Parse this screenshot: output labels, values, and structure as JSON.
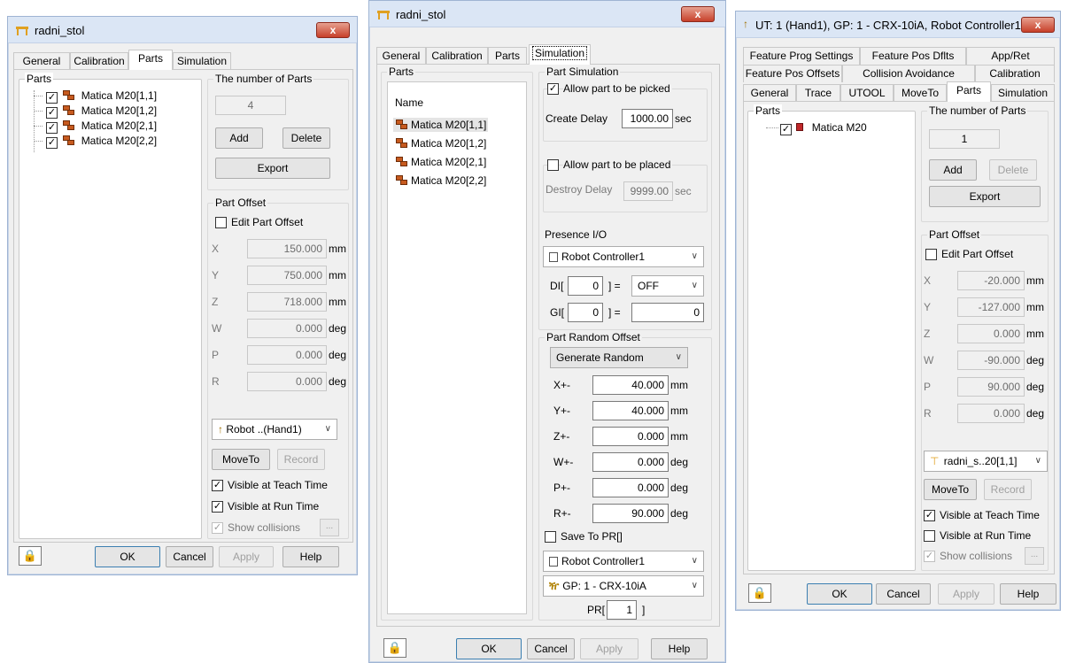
{
  "win1": {
    "title": "radni_stol",
    "close": "x",
    "tabs": [
      "General",
      "Calibration",
      "Parts",
      "Simulation"
    ],
    "parts_label": "Parts",
    "parts": [
      "Matica M20[1,1]",
      "Matica M20[1,2]",
      "Matica M20[2,1]",
      "Matica M20[2,2]"
    ],
    "num_label": "The number of Parts",
    "num_value": "4",
    "add": "Add",
    "delete": "Delete",
    "export": "Export",
    "offset_label": "Part Offset",
    "edit_offset": "Edit Part Offset",
    "axes": [
      {
        "name": "X",
        "value": "150.000",
        "unit": "mm"
      },
      {
        "name": "Y",
        "value": "750.000",
        "unit": "mm"
      },
      {
        "name": "Z",
        "value": "718.000",
        "unit": "mm"
      },
      {
        "name": "W",
        "value": "0.000",
        "unit": "deg"
      },
      {
        "name": "P",
        "value": "0.000",
        "unit": "deg"
      },
      {
        "name": "R",
        "value": "0.000",
        "unit": "deg"
      }
    ],
    "tool_combo": "Robot ..(Hand1)",
    "moveto": "MoveTo",
    "record": "Record",
    "visible_teach": "Visible at Teach Time",
    "visible_run": "Visible at Run Time",
    "show_collisions": "Show collisions",
    "ellipsis": "...",
    "ok": "OK",
    "cancel": "Cancel",
    "apply": "Apply",
    "help": "Help"
  },
  "win2": {
    "title": "radni_stol",
    "close": "x",
    "tabs": [
      "General",
      "Calibration",
      "Parts",
      "Simulation"
    ],
    "parts_label": "Parts",
    "name_header": "Name",
    "parts": [
      "Matica M20[1,1]",
      "Matica M20[1,2]",
      "Matica M20[2,1]",
      "Matica M20[2,2]"
    ],
    "sim_label": "Part Simulation",
    "allow_pick": "Allow part to be picked",
    "create_delay": "Create Delay",
    "create_delay_value": "1000.00",
    "sec": "sec",
    "allow_place": "Allow part to be placed",
    "destroy_delay": "Destroy Delay",
    "destroy_delay_value": "9999.00",
    "presence_label": "Presence I/O",
    "controller": "Robot Controller1",
    "di": "DI[",
    "di_value": "0",
    "eq": "] =",
    "di_state": "OFF",
    "gi": "GI[",
    "gi_value": "0",
    "gi_result": "0",
    "random_label": "Part Random Offset",
    "generate": "Generate Random",
    "random_axes": [
      {
        "name": "X+-",
        "value": "40.000",
        "unit": "mm"
      },
      {
        "name": "Y+-",
        "value": "40.000",
        "unit": "mm"
      },
      {
        "name": "Z+-",
        "value": "0.000",
        "unit": "mm"
      },
      {
        "name": "W+-",
        "value": "0.000",
        "unit": "deg"
      },
      {
        "name": "P+-",
        "value": "0.000",
        "unit": "deg"
      },
      {
        "name": "R+-",
        "value": "90.000",
        "unit": "deg"
      }
    ],
    "save_pr": "Save To PR[]",
    "controller2": "Robot Controller1",
    "group": "GP: 1 - CRX-10iA",
    "pr": "PR[",
    "pr_value": "1",
    "pr_close": "]",
    "ok": "OK",
    "cancel": "Cancel",
    "apply": "Apply",
    "help": "Help"
  },
  "win3": {
    "title": "UT: 1  (Hand1), GP: 1 - CRX-10iA, Robot Controller1",
    "close": "x",
    "tabs_row1": [
      "Feature Prog Settings",
      "Feature Pos Dflts",
      "App/Ret"
    ],
    "tabs_row2": [
      "Feature Pos Offsets",
      "Collision Avoidance",
      "Calibration"
    ],
    "tabs_row3": [
      "General",
      "Trace",
      "UTOOL",
      "MoveTo",
      "Parts",
      "Simulation"
    ],
    "parts_label": "Parts",
    "part": "Matica M20",
    "num_label": "The number of Parts",
    "num_value": "1",
    "add": "Add",
    "delete": "Delete",
    "export": "Export",
    "offset_label": "Part Offset",
    "edit_offset": "Edit Part Offset",
    "axes": [
      {
        "name": "X",
        "value": "-20.000",
        "unit": "mm"
      },
      {
        "name": "Y",
        "value": "-127.000",
        "unit": "mm"
      },
      {
        "name": "Z",
        "value": "0.000",
        "unit": "mm"
      },
      {
        "name": "W",
        "value": "-90.000",
        "unit": "deg"
      },
      {
        "name": "P",
        "value": "90.000",
        "unit": "deg"
      },
      {
        "name": "R",
        "value": "0.000",
        "unit": "deg"
      }
    ],
    "frame_combo": "radni_s..20[1,1]",
    "moveto": "MoveTo",
    "record": "Record",
    "visible_teach": "Visible at Teach Time",
    "visible_run": "Visible at Run Time",
    "show_collisions": "Show collisions",
    "ellipsis": "...",
    "ok": "OK",
    "cancel": "Cancel",
    "apply": "Apply",
    "help": "Help"
  },
  "icons": {
    "check": "✓",
    "lock": "🔒",
    "arrow": "∨",
    "tool": "↑"
  }
}
